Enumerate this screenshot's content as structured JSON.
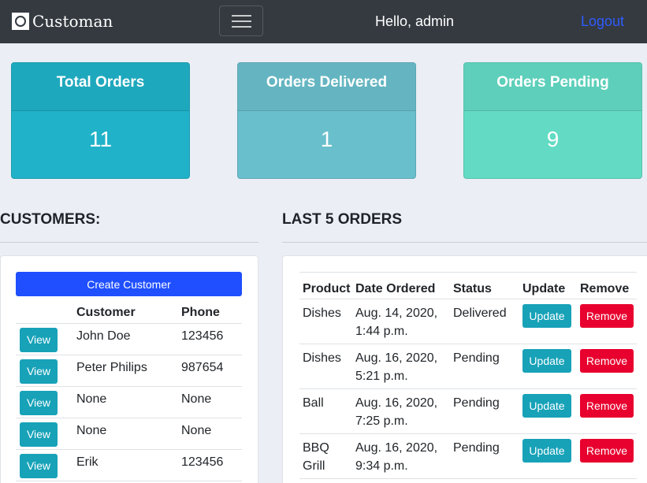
{
  "navbar": {
    "brand": "Customan",
    "greeting": "Hello, admin",
    "logout": "Logout"
  },
  "stats": [
    {
      "title": "Total Orders",
      "value": "11",
      "color": "#20b2c8"
    },
    {
      "title": "Orders Delivered",
      "value": "1",
      "color": "#6abfcc"
    },
    {
      "title": "Orders Pending",
      "value": "9",
      "color": "#63dbc4"
    }
  ],
  "customers": {
    "title": "CUSTOMERS:",
    "create_label": "Create Customer",
    "columns": [
      "",
      "Customer",
      "Phone"
    ],
    "view_label": "View",
    "rows": [
      {
        "name": "John Doe",
        "phone": "123456"
      },
      {
        "name": "Peter Philips",
        "phone": "987654"
      },
      {
        "name": "None",
        "phone": "None"
      },
      {
        "name": "None",
        "phone": "None"
      },
      {
        "name": "Erik",
        "phone": "123456"
      }
    ]
  },
  "orders": {
    "title": "LAST 5 ORDERS",
    "columns": [
      "Product",
      "Date Ordered",
      "Status",
      "Update",
      "Remove"
    ],
    "update_label": "Update",
    "remove_label": "Remove",
    "rows": [
      {
        "product": "Dishes",
        "date_line1": "Aug. 14, 2020,",
        "date_line2": "1:44 p.m.",
        "status": "Delivered"
      },
      {
        "product": "Dishes",
        "date_line1": "Aug. 16, 2020,",
        "date_line2": "5:21 p.m.",
        "status": "Pending"
      },
      {
        "product": "Ball",
        "date_line1": "Aug. 16, 2020,",
        "date_line2": "7:25 p.m.",
        "status": "Pending"
      },
      {
        "product_line1": "BBQ",
        "product_line2": "Grill",
        "date_line1": "Aug. 16, 2020,",
        "date_line2": "9:34 p.m.",
        "status": "Pending"
      }
    ]
  }
}
